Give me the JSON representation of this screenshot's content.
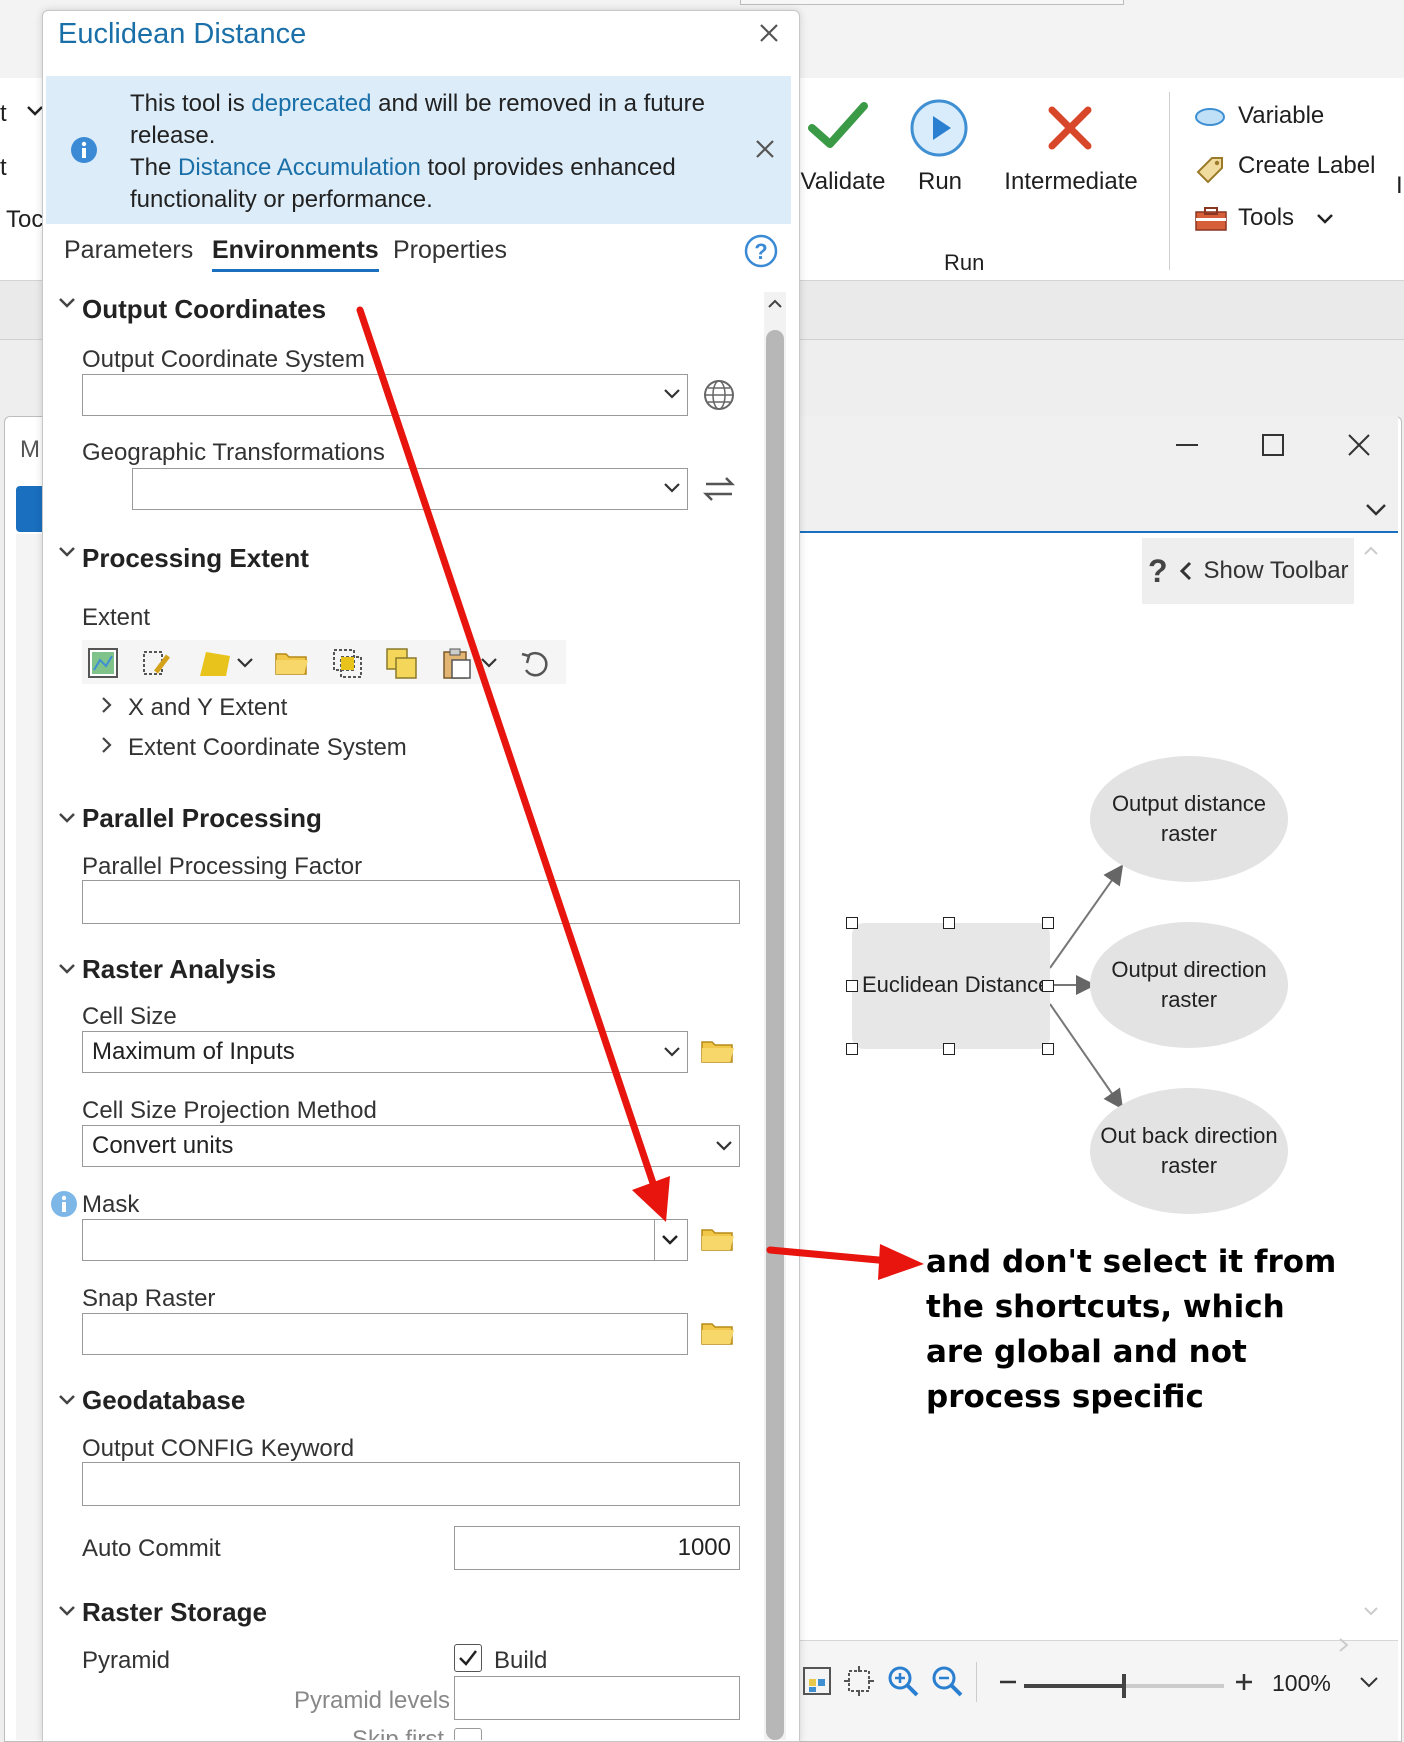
{
  "ribbon": {
    "partial_left_1": "t",
    "partial_left_2": "t",
    "partial_left_3": "Toc",
    "validate": "Validate",
    "run": "Run",
    "intermediate": "Intermediate",
    "group_run": "Run",
    "variable": "Variable",
    "create_label": "Create Label",
    "tools": "Tools",
    "partial_right": "I"
  },
  "model_window": {
    "partial_tab": "M",
    "show_toolbar": "Show Toolbar",
    "help_glyph": "?",
    "process": "Euclidean Distance",
    "outputs": [
      "Output distance raster",
      "Output direction raster",
      "Out back direction raster"
    ],
    "zoom": "100%"
  },
  "tool": {
    "title": "Euclidean Distance",
    "info_line1_pre": "This tool is ",
    "info_line1_link": "deprecated",
    "info_line1_post": " and will be removed in a future release.",
    "info_line2_pre": "The ",
    "info_line2_link": "Distance Accumulation",
    "info_line2_post": " tool provides enhanced functionality or performance.",
    "tabs": [
      "Parameters",
      "Environments",
      "Properties"
    ],
    "sections": {
      "output_coordinates": "Output Coordinates",
      "output_cs_label": "Output Coordinate System",
      "geo_trans_label": "Geographic Transformations",
      "processing_extent": "Processing Extent",
      "extent_label": "Extent",
      "xy_extent": "X and Y Extent",
      "extent_cs": "Extent Coordinate System",
      "parallel_processing": "Parallel Processing",
      "ppf_label": "Parallel Processing Factor",
      "raster_analysis": "Raster Analysis",
      "cell_size_label": "Cell Size",
      "cell_size_value": "Maximum of Inputs",
      "cspm_label": "Cell Size Projection Method",
      "cspm_value": "Convert units",
      "mask_label": "Mask",
      "snap_label": "Snap Raster",
      "geodatabase": "Geodatabase",
      "config_label": "Output CONFIG Keyword",
      "auto_commit_label": "Auto Commit",
      "auto_commit_value": "1000",
      "raster_storage": "Raster Storage",
      "pyramid_label": "Pyramid",
      "build_label": "Build",
      "pyramid_levels_label": "Pyramid levels",
      "skip_first_partial": "Skip first"
    }
  },
  "annotation": {
    "text": "and don't select it from the shortcuts, which are global and not process specific"
  },
  "colors": {
    "accent": "#1a6fbf",
    "arrow": "#e8150f",
    "info_bg": "#dcecf8",
    "validate_green": "#3a9a46",
    "intermediate_red": "#d9472b"
  }
}
